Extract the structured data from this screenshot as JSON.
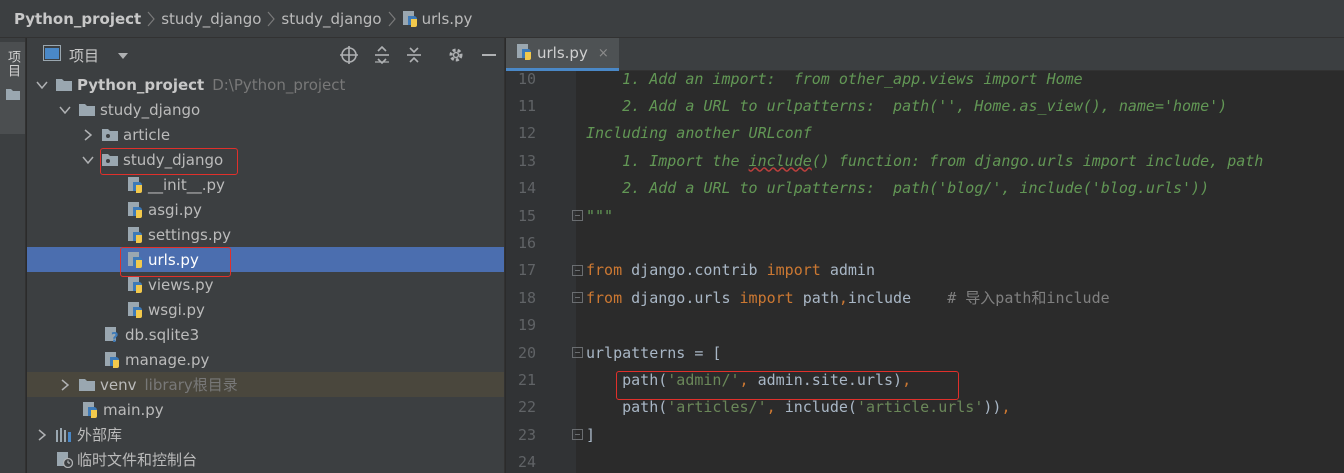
{
  "breadcrumb": {
    "items": [
      "Python_project",
      "study_django",
      "study_django",
      "urls.py"
    ]
  },
  "left_strip": {
    "tab_label": "项目"
  },
  "project_panel": {
    "title": "项目",
    "tree": [
      {
        "label": "Python_project",
        "hint": "D:\\Python_project",
        "type": "folder",
        "expanded": true
      },
      {
        "label": "study_django",
        "type": "folder",
        "expanded": true
      },
      {
        "label": "article",
        "type": "package",
        "expanded": false
      },
      {
        "label": "study_django",
        "type": "package",
        "expanded": true
      },
      {
        "label": "__init__.py",
        "type": "python"
      },
      {
        "label": "asgi.py",
        "type": "python"
      },
      {
        "label": "settings.py",
        "type": "python"
      },
      {
        "label": "urls.py",
        "type": "python",
        "selected": true
      },
      {
        "label": "views.py",
        "type": "python"
      },
      {
        "label": "wsgi.py",
        "type": "python"
      },
      {
        "label": "db.sqlite3",
        "type": "db"
      },
      {
        "label": "manage.py",
        "type": "python"
      },
      {
        "label": "venv",
        "hint": "library根目录",
        "type": "folder",
        "expanded": false
      },
      {
        "label": "main.py",
        "type": "python"
      },
      {
        "label": "外部库",
        "type": "library",
        "expanded": false
      },
      {
        "label": "临时文件和控制台",
        "type": "scratch"
      }
    ]
  },
  "editor": {
    "tab": {
      "label": "urls.py",
      "close": "×"
    },
    "lines": [
      {
        "n": "10",
        "parts": [
          [
            "doc",
            "    1. Add an import:  from other_app.views import Home"
          ]
        ]
      },
      {
        "n": "11",
        "parts": [
          [
            "doc",
            "    2. Add a URL to urlpatterns:  path('', Home.as_view(), name='home')"
          ]
        ]
      },
      {
        "n": "12",
        "parts": [
          [
            "doc",
            "Including another URLconf"
          ]
        ]
      },
      {
        "n": "13",
        "parts": [
          [
            "doc",
            "    1. Import the "
          ],
          [
            "docu",
            "include"
          ],
          [
            "doc",
            "() function: from django.urls import include, path"
          ]
        ]
      },
      {
        "n": "14",
        "parts": [
          [
            "doc",
            "    2. Add a URL to urlpatterns:  path('blog/', include('blog.urls'))"
          ]
        ]
      },
      {
        "n": "15",
        "parts": [
          [
            "doc",
            "\"\"\""
          ]
        ]
      },
      {
        "n": "16",
        "parts": []
      },
      {
        "n": "17",
        "parts": [
          [
            "kw",
            "from "
          ],
          [
            "tx",
            "django.contrib "
          ],
          [
            "kw",
            "import "
          ],
          [
            "tx",
            "admin"
          ]
        ]
      },
      {
        "n": "18",
        "parts": [
          [
            "kw",
            "from "
          ],
          [
            "tx",
            "django.urls "
          ],
          [
            "kw",
            "import "
          ],
          [
            "tx",
            "path"
          ],
          [
            "kw",
            ","
          ],
          [
            "tx",
            "include    "
          ],
          [
            "cm",
            "# 导入path和include"
          ]
        ]
      },
      {
        "n": "19",
        "parts": []
      },
      {
        "n": "20",
        "parts": [
          [
            "tx",
            "urlpatterns = ["
          ]
        ]
      },
      {
        "n": "21",
        "parts": [
          [
            "tx",
            "    path("
          ],
          [
            "str",
            "'admin/'"
          ],
          [
            "kw",
            ", "
          ],
          [
            "tx",
            "admin.site.urls)"
          ],
          [
            "kw",
            ","
          ]
        ]
      },
      {
        "n": "22",
        "parts": [
          [
            "tx",
            "    path("
          ],
          [
            "str",
            "'articles/'"
          ],
          [
            "kw",
            ", "
          ],
          [
            "tx",
            "include("
          ],
          [
            "str",
            "'article.urls'"
          ],
          [
            "tx",
            "))"
          ],
          [
            "kw",
            ","
          ]
        ]
      },
      {
        "n": "23",
        "parts": [
          [
            "tx",
            "]"
          ]
        ]
      },
      {
        "n": "24",
        "parts": []
      }
    ]
  },
  "colors": {
    "selection": "#4b6eaf",
    "highlight_box": "#e0302b",
    "docstring": "#629755",
    "keyword": "#cc7832",
    "string": "#6a8759"
  },
  "icons": [
    "project-view-icon",
    "locate-icon",
    "expand-all-icon",
    "collapse-all-icon",
    "settings-gear-icon",
    "minimize-icon",
    "python-file-icon",
    "folder-icon",
    "package-icon",
    "database-icon",
    "library-icon",
    "scratch-icon"
  ]
}
